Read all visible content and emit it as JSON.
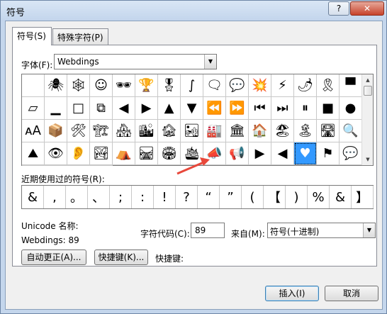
{
  "window": {
    "title": "符号",
    "help_label": "?",
    "close_label": "✕"
  },
  "tabs": [
    {
      "label": "符号(S)",
      "active": true
    },
    {
      "label": "特殊字符(P)",
      "active": false
    }
  ],
  "font": {
    "label": "字体(F):",
    "value": "Webdings"
  },
  "symbol_grid": [
    "",
    "🕷",
    "🕸",
    "☺",
    "🕶",
    "🏆",
    "🎖",
    "∫",
    "🗨",
    "💬",
    "💥",
    "⚡",
    "🌶",
    "🎗",
    "▀",
    "▱",
    "▁",
    "□",
    "⧉",
    "◀",
    "▶",
    "▲",
    "▼",
    "⏪",
    "⏩",
    "⏮",
    "⏭",
    "⏸",
    "■",
    "●",
    "ᴀA",
    "📦",
    "🛠",
    "🏗",
    "🏘",
    "🏙",
    "🏚",
    "🏜",
    "🏭",
    "🏛",
    "🏠",
    "🏖",
    "🏝",
    "🛣",
    "🔍",
    "⛰",
    "👁",
    "👂",
    "🏞",
    "⛺",
    "🛤",
    "🏟",
    "🛳",
    "📣",
    "📢",
    "▶",
    "◀",
    "♥",
    "⚑",
    "💬",
    "▰",
    "💬",
    "🗨",
    "🗯"
  ],
  "selected_index": 57,
  "recent": {
    "label": "近期使用过的符号(R):",
    "symbols": [
      "&",
      ",",
      "。",
      "、",
      ";",
      ":",
      "!",
      "?",
      "“",
      "”",
      "(",
      "【",
      ")",
      "%",
      "&",
      "】"
    ]
  },
  "unicode_name_label": "Unicode 名称:",
  "char_name": "Webdings: 89",
  "char_code": {
    "label": "字符代码(C):",
    "value": "89"
  },
  "from": {
    "label": "来自(M):",
    "value": "符号(十进制)"
  },
  "buttons": {
    "autocorrect": "自动更正(A)...",
    "shortcut_key": "快捷键(K)...",
    "shortcut_label": "快捷键:",
    "insert": "插入(I)",
    "cancel": "取消"
  },
  "colors": {
    "selection": "#3399ff",
    "arrow": "#e8483b"
  }
}
